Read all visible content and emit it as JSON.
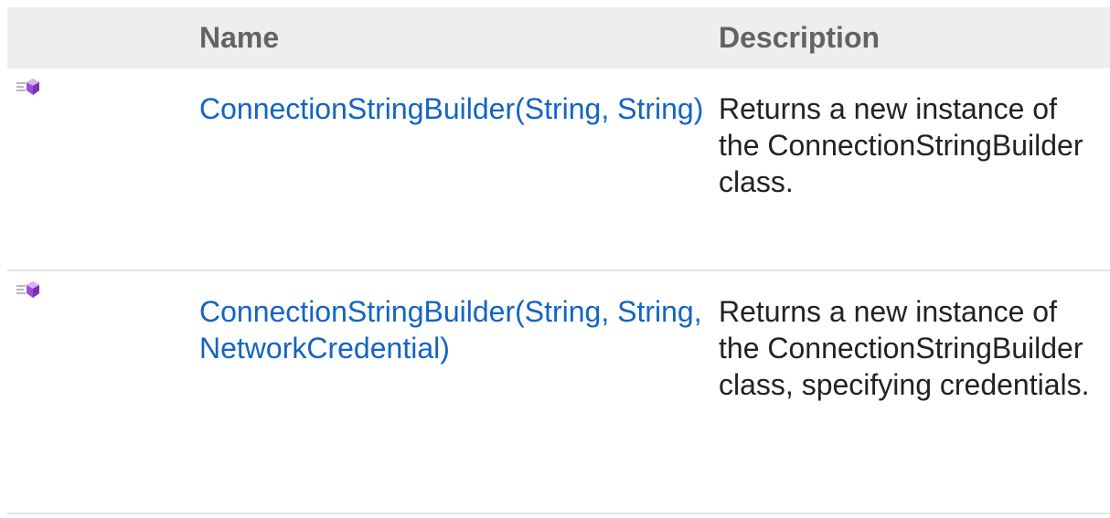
{
  "table": {
    "header": {
      "name": "Name",
      "description": "Description"
    },
    "rows": [
      {
        "icon": "public-method-icon",
        "name": "ConnectionStringBuilder(String, String)",
        "description": "Returns a new instance of the ConnectionStringBuilder class."
      },
      {
        "icon": "public-method-icon",
        "name": "ConnectionStringBuilder(String, String, NetworkCredential)",
        "description": "Returns a new instance of the ConnectionStringBuilder class, specifying credentials."
      }
    ]
  },
  "colors": {
    "link": "#1364c4",
    "header_bg": "#eeeeee",
    "header_text": "#636363",
    "icon_purple": "#a855f7"
  }
}
